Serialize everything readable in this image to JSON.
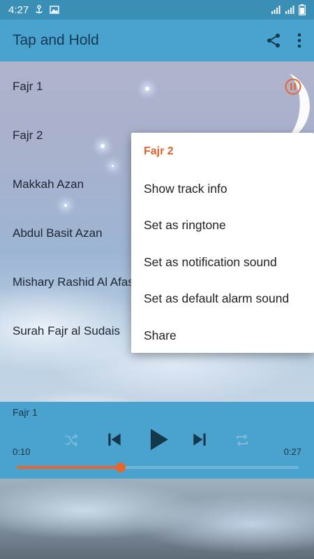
{
  "status_bar": {
    "time": "4:27"
  },
  "app_bar": {
    "title": "Tap and Hold"
  },
  "tracks": [
    {
      "label": "Fajr 1"
    },
    {
      "label": "Fajr 2"
    },
    {
      "label": "Makkah Azan"
    },
    {
      "label": "Abdul Basit Azan"
    },
    {
      "label": "Mishary Rashid Al Afasy"
    },
    {
      "label": "Surah Fajr al Sudais"
    }
  ],
  "player": {
    "now_playing": "Fajr 1",
    "elapsed": "0:10",
    "duration": "0:27",
    "progress_fraction": 0.37
  },
  "context_menu": {
    "title": "Fajr 2",
    "items": [
      "Show track info",
      "Set as ringtone",
      "Set as notification sound",
      "Set as default alarm sound",
      "Share"
    ]
  },
  "colors": {
    "accent": "#e8662e",
    "app_bar": "#4aa3cf",
    "status_bar": "#3a8fb7"
  }
}
